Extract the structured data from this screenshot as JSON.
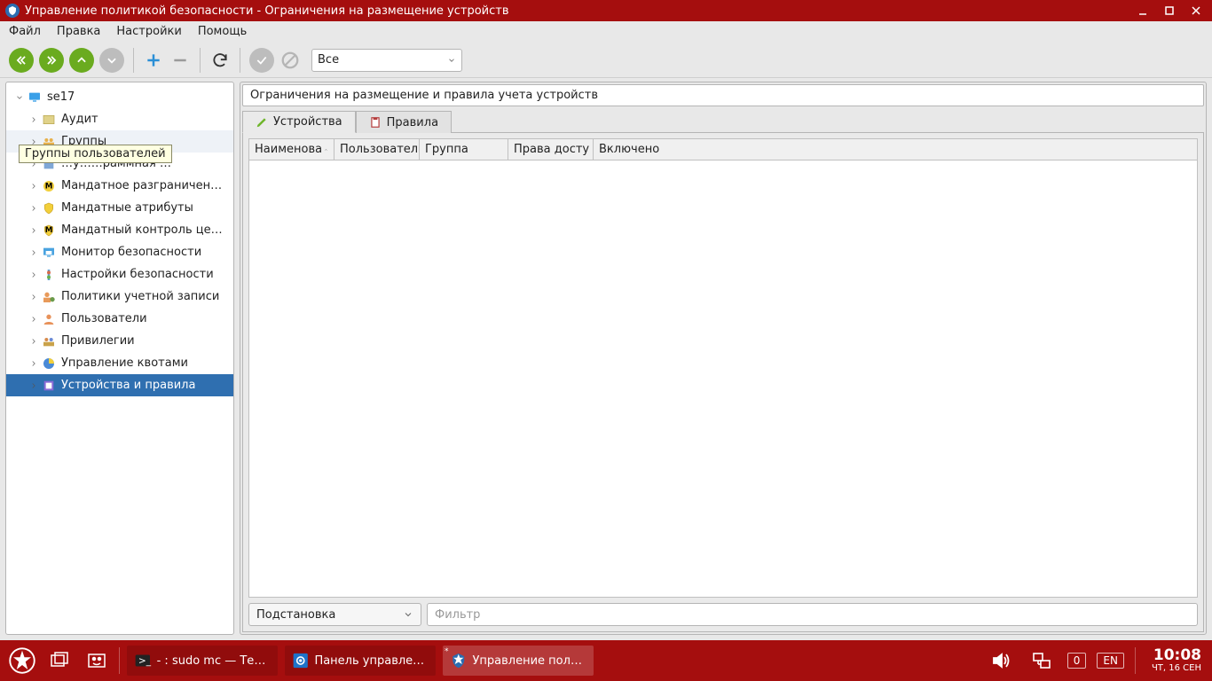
{
  "titlebar": {
    "title": "Управление политикой безопасности - Ограничения на размещение устройств"
  },
  "menu": {
    "file": "Файл",
    "edit": "Правка",
    "settings": "Настройки",
    "help": "Помощь"
  },
  "combo": {
    "value": "Все"
  },
  "tooltip": "Группы пользователей",
  "tree": {
    "root": "se17",
    "items": [
      {
        "label": "Аудит",
        "icon": "audit"
      },
      {
        "label": "Группы",
        "icon": "groups",
        "hover": true
      },
      {
        "label": "…у……раммная …",
        "icon": "app",
        "obscured": true
      },
      {
        "label": "Мандатное разграничен…",
        "icon": "mandatory-m"
      },
      {
        "label": "Мандатные атрибуты",
        "icon": "mandatory-attr"
      },
      {
        "label": "Мандатный контроль це…",
        "icon": "mandatory-ctl"
      },
      {
        "label": "Монитор безопасности",
        "icon": "monitor"
      },
      {
        "label": "Настройки безопасности",
        "icon": "security-settings"
      },
      {
        "label": "Политики учетной записи",
        "icon": "account-policy"
      },
      {
        "label": "Пользователи",
        "icon": "users"
      },
      {
        "label": "Привилегии",
        "icon": "privileges"
      },
      {
        "label": "Управление квотами",
        "icon": "quota"
      },
      {
        "label": "Устройства и правила",
        "icon": "devices",
        "selected": true
      }
    ]
  },
  "panel": {
    "title": "Ограничения на размещение и правила учета устройств",
    "tabs": {
      "devices": "Устройства",
      "rules": "Правила"
    },
    "columns": {
      "name": "Наименова",
      "user": "Пользовател",
      "group": "Группа",
      "rights": "Права досту",
      "enabled": "Включено"
    },
    "select": "Подстановка",
    "filter_placeholder": "Фильтр"
  },
  "taskbar": {
    "task1": "- : sudo mc — Тер…",
    "task2": "Панель управлен…",
    "task3": "Управление поли…",
    "notif": "0",
    "lang": "EN",
    "time": "10:08",
    "date": "ЧТ, 16 СЕН"
  }
}
